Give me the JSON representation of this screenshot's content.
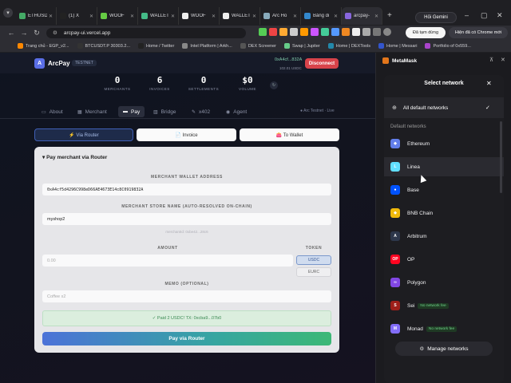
{
  "browser": {
    "tabs": [
      {
        "title": "ETHUSD",
        "color": "#4a6"
      },
      {
        "title": "(1) X",
        "color": "#222"
      },
      {
        "title": "WOOF",
        "color": "#6c4"
      },
      {
        "title": "WALLET",
        "color": "#4b8"
      },
      {
        "title": "WOOF",
        "color": "#eee"
      },
      {
        "title": "WALLET",
        "color": "#eee"
      },
      {
        "title": "Arc Ho",
        "color": "#8ab"
      },
      {
        "title": "Bảng đi",
        "color": "#38c"
      },
      {
        "title": "arcpay-",
        "color": "#86d",
        "active": true
      }
    ],
    "new_tab_symbol": "+",
    "gemini_label": "Hỏi Gemini",
    "url": "arcpay-ui.vercel.app",
    "pause_label": "Đã tạm dừng",
    "chrome_label": "Hiện đã có Chrome mới",
    "bookmarks": [
      {
        "label": "Trang chủ - EGP_v2...",
        "color": "#f80"
      },
      {
        "label": "BTCUSDT.P 30303.2...",
        "color": "#333"
      },
      {
        "label": "Home / Twitter",
        "color": "#222"
      },
      {
        "label": "Intel Platform | Arkh...",
        "color": "#888"
      },
      {
        "label": "DEX Screener",
        "color": "#555"
      },
      {
        "label": "Swap | Jupiter",
        "color": "#6c8"
      },
      {
        "label": "Home | DEXTools",
        "color": "#28a"
      },
      {
        "label": "Home | Messari",
        "color": "#35c"
      },
      {
        "label": "Portfolio of 0x559...",
        "color": "#a4c"
      }
    ]
  },
  "app": {
    "logo_letter": "A",
    "name": "ArcPay",
    "badge": "TESTNET",
    "wallet_address": "0xA4cf...832A",
    "wallet_balance": "102.01 USDC",
    "disconnect_label": "Disconnect",
    "stats": [
      {
        "value": "0",
        "label": "MERCHANTS"
      },
      {
        "value": "6",
        "label": "INVOICES"
      },
      {
        "value": "0",
        "label": "SETTLEMENTS"
      },
      {
        "value": "$0",
        "label": "VOLUME"
      }
    ],
    "refresh_symbol": "↻",
    "nav_tabs": [
      {
        "label": "About",
        "icon": "▭"
      },
      {
        "label": "Merchant",
        "icon": "▦"
      },
      {
        "label": "Pay",
        "icon": "▬",
        "active": true
      },
      {
        "label": "Bridge",
        "icon": "▥"
      },
      {
        "label": "x402",
        "icon": "✎"
      },
      {
        "label": "Agent",
        "icon": "◉"
      }
    ],
    "network_status": "● Arc Testnet · Live",
    "modes": {
      "router": "⚡ Via Router",
      "invoice": "📄 Invoice",
      "wallet": "👛 To Wallet"
    },
    "card": {
      "title": "▾  Pay merchant via Router",
      "merchant_address_label": "MERCHANT WALLET ADDRESS",
      "merchant_address_value": "0xA4cf5d4296C998eD66AE4673E14c8C0919832A",
      "store_name_label": "MERCHANT STORE NAME (AUTO-RESOLVED ON-CHAIN)",
      "store_name_value": "myshop2",
      "merchant_id_hint": "merchantId: 0xbe42...28c6",
      "amount_label": "AMOUNT",
      "amount_placeholder": "0.00",
      "token_label": "TOKEN",
      "token_usdc": "USDC",
      "token_eurc": "EURC",
      "memo_label": "MEMO (OPTIONAL)",
      "memo_placeholder": "Coffee x2",
      "success_message": "✓ Paid 2 USDC! TX: 0xcba9...07b0",
      "pay_button": "Pay via Router"
    }
  },
  "metamask": {
    "panel_title": "MetaMask",
    "modal_title": "Select network",
    "close_symbol": "✕",
    "all_networks_label": "All default networks",
    "section_label": "Default networks",
    "networks": [
      {
        "name": "Ethereum",
        "color": "#627eea",
        "glyph": "◆"
      },
      {
        "name": "Linea",
        "color": "#61dfff",
        "glyph": "L"
      },
      {
        "name": "Base",
        "color": "#0052ff",
        "glyph": "●"
      },
      {
        "name": "BNB Chain",
        "color": "#f0b90b",
        "glyph": "◆"
      },
      {
        "name": "Arbitrum",
        "color": "#2d374b",
        "glyph": "A"
      },
      {
        "name": "OP",
        "color": "#ff0420",
        "glyph": "OP"
      },
      {
        "name": "Polygon",
        "color": "#8247e5",
        "glyph": "∞"
      },
      {
        "name": "Sei",
        "color": "#9e1f19",
        "glyph": "S",
        "badge": "No network fee"
      },
      {
        "name": "Monad",
        "color": "#836ef9",
        "glyph": "M",
        "badge": "No network fee"
      }
    ],
    "manage_label": "Manage networks"
  }
}
